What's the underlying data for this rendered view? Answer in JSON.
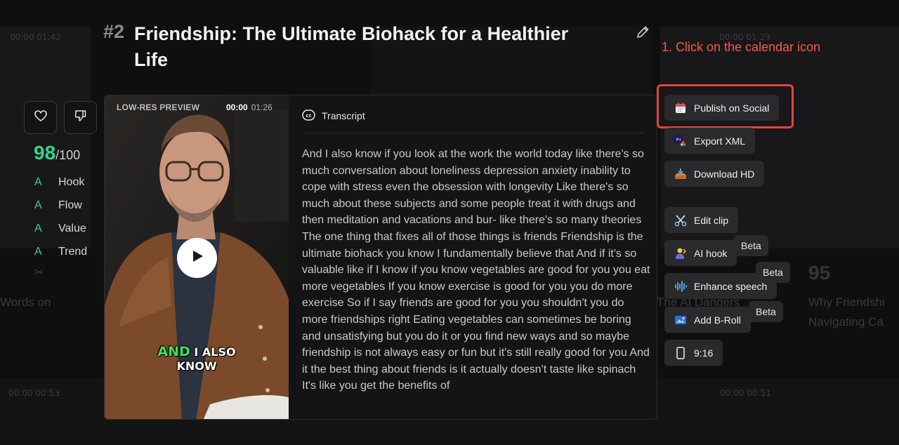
{
  "background": {
    "times": [
      "00:00 01:42",
      "00:00 01:29",
      "00:00 00:53",
      "00:00 00:51"
    ],
    "texts": [
      "Words on",
      "The AI Dangers",
      "Why Friendshi",
      "Navigating Ca"
    ],
    "score": "95"
  },
  "title": {
    "number": "#2",
    "text": "Friendship: The Ultimate Biohack for a Healthier Life"
  },
  "annotation": "1. Click on the calendar icon",
  "score": {
    "value": "98",
    "max": "/100"
  },
  "grades": [
    {
      "letter": "A",
      "label": "Hook"
    },
    {
      "letter": "A",
      "label": "Flow"
    },
    {
      "letter": "A",
      "label": "Value"
    },
    {
      "letter": "A",
      "label": "Trend"
    }
  ],
  "video": {
    "label": "LOW-RES PREVIEW",
    "current_time": "00:00",
    "duration": "01:26",
    "caption_highlight": "AND",
    "caption_line1_rest": " I ALSO",
    "caption_line2": "KNOW"
  },
  "transcript": {
    "heading": "Transcript",
    "body": "And I also know if you look at the work the world today like there's so much conversation about loneliness depression anxiety inability to cope with stress even the obsession with longevity Like there's so much about these subjects and some people treat it with drugs and then meditation and vacations and bur- like there's so many theories The one thing that fixes all of those things is friends Friendship is the ultimate biohack you know I fundamentally believe that And if it's so valuable like if I know if you know vegetables are good for you you eat more vegetables If you know exercise is good for you you do more exercise So if I say friends are good for you you shouldn't you do more friendships right Eating vegetables can sometimes be boring and unsatisfying but you do it or you find new ways and so maybe friendship is not always easy or fun but it's still really good for you And it the best thing about friends is it actually doesn't taste like spinach It's like you get the benefits of"
  },
  "actions": {
    "publish": "Publish on Social",
    "export_xml": "Export XML",
    "download_hd": "Download HD",
    "edit_clip": "Edit clip",
    "ai_hook": "AI hook",
    "enhance_speech": "Enhance speech",
    "add_broll": "Add B-Roll",
    "aspect": "9:16",
    "beta": "Beta"
  },
  "colors": {
    "accent_green": "#35d48a",
    "annotation_red": "#f2594b",
    "highlight_red": "#e2453a"
  }
}
